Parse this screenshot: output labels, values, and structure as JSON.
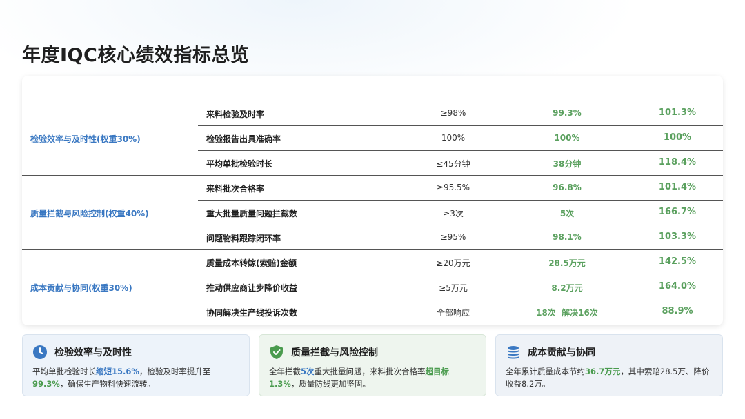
{
  "title": "年度IQC核心绩效指标总览",
  "groups": [
    {
      "label": "检验效率与及时性(权重30%)",
      "rows": [
        {
          "name": "来料检验及时率",
          "target": "≥98%",
          "actual": "99.3%",
          "rate": "101.3%"
        },
        {
          "name": "检验报告出具准确率",
          "target": "100%",
          "actual": "100%",
          "rate": "100%"
        },
        {
          "name": "平均单批检验时长",
          "target": "≤45分钟",
          "actual": "38分钟",
          "rate": "118.4%"
        }
      ]
    },
    {
      "label": "质量拦截与风险控制(权重40%)",
      "rows": [
        {
          "name": "来料批次合格率",
          "target": "≥95.5%",
          "actual": "96.8%",
          "rate": "101.4%"
        },
        {
          "name": "重大批量质量问题拦截数",
          "target": "≥3次",
          "actual": "5次",
          "rate": "166.7%"
        },
        {
          "name": "问题物料跟踪闭环率",
          "target": "≥95%",
          "actual": "98.1%",
          "rate": "103.3%"
        }
      ]
    },
    {
      "label": "成本贡献与协同(权重30%)",
      "rows": [
        {
          "name": "质量成本转嫁(索赔)金额",
          "target": "≥20万元",
          "actual": "28.5万元",
          "rate": "142.5%"
        },
        {
          "name": "推动供应商让步降价收益",
          "target": "≥5万元",
          "actual": "8.2万元",
          "rate": "164.0%"
        },
        {
          "name": "协同解决生产线投诉次数",
          "target": "全部响应",
          "actual": "18次  解决16次",
          "rate": "88.9%"
        }
      ]
    }
  ],
  "summaries": {
    "efficiency": {
      "icon": "clock-icon",
      "title": "检验效率与及时性",
      "p1": "平均单批检验时长",
      "h1": "缩短15.6%",
      "p2": "，检验及时率提升至",
      "h2": "99.3%",
      "p3": "，确保生产物料快速流转。"
    },
    "quality": {
      "icon": "shield-check-icon",
      "title": "质量拦截与风险控制",
      "p1": "全年拦截",
      "h1": "5次",
      "p2": "重大批量问题，来料批次合格率",
      "h2": "超目标1.3%",
      "p3": "，质量防线更加坚固。"
    },
    "cost": {
      "icon": "coins-icon",
      "title": "成本贡献与协同",
      "p1": "全年累计质量成本节约",
      "h1": "36.7万元",
      "p2": "，其中索赔28.5万、降价收益8.2万。"
    }
  },
  "colors": {
    "accent_blue": "#3a78c2",
    "accent_green": "#5aa05e"
  }
}
